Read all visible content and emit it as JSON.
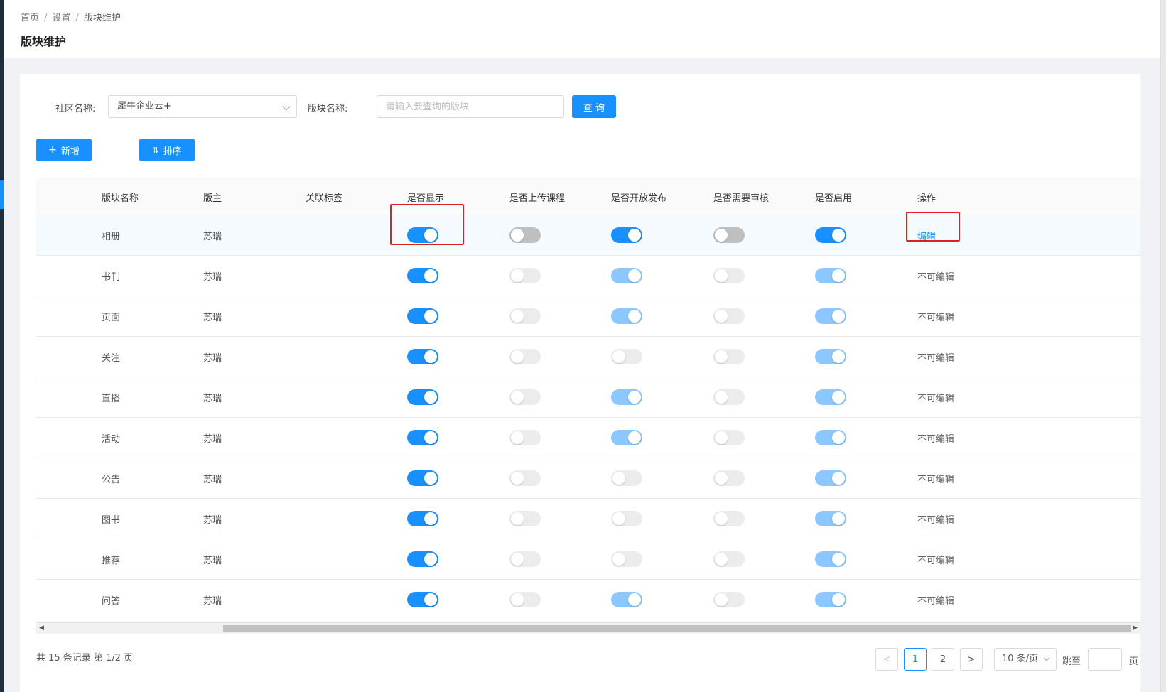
{
  "breadcrumb": [
    "首页",
    "设置",
    "版块维护"
  ],
  "page_title": "版块维护",
  "filters": {
    "community_label": "社区名称:",
    "community_value": "犀牛企业云+",
    "section_label": "版块名称:",
    "section_placeholder": "请输入要查询的版块",
    "query_button": "查 询"
  },
  "actions": {
    "add_label": "新增",
    "sort_label": "排序"
  },
  "table": {
    "columns": [
      "版块名称",
      "版主",
      "关联标签",
      "是否显示",
      "是否上传课程",
      "是否开放发布",
      "是否需要审核",
      "是否启用",
      "操作"
    ],
    "rows": [
      {
        "name": "相册",
        "owner": "苏瑞",
        "tag": "",
        "toggles": [
          "on",
          "off",
          "on",
          "off",
          "on"
        ],
        "action": "编辑"
      },
      {
        "name": "书刊",
        "owner": "苏瑞",
        "tag": "",
        "toggles": [
          "on",
          "off-dis",
          "on-dis",
          "off-dis",
          "on-dis"
        ],
        "action": "不可编辑"
      },
      {
        "name": "页面",
        "owner": "苏瑞",
        "tag": "",
        "toggles": [
          "on",
          "off-dis",
          "on-dis",
          "off-dis",
          "on-dis"
        ],
        "action": "不可编辑"
      },
      {
        "name": "关注",
        "owner": "苏瑞",
        "tag": "",
        "toggles": [
          "on",
          "off-dis",
          "off-dis",
          "off-dis",
          "on-dis"
        ],
        "action": "不可编辑"
      },
      {
        "name": "直播",
        "owner": "苏瑞",
        "tag": "",
        "toggles": [
          "on",
          "off-dis",
          "on-dis",
          "off-dis",
          "on-dis"
        ],
        "action": "不可编辑"
      },
      {
        "name": "活动",
        "owner": "苏瑞",
        "tag": "",
        "toggles": [
          "on",
          "off-dis",
          "on-dis",
          "off-dis",
          "on-dis"
        ],
        "action": "不可编辑"
      },
      {
        "name": "公告",
        "owner": "苏瑞",
        "tag": "",
        "toggles": [
          "on",
          "off-dis",
          "off-dis",
          "off-dis",
          "on-dis"
        ],
        "action": "不可编辑"
      },
      {
        "name": "图书",
        "owner": "苏瑞",
        "tag": "",
        "toggles": [
          "on",
          "off-dis",
          "off-dis",
          "off-dis",
          "on-dis"
        ],
        "action": "不可编辑"
      },
      {
        "name": "推荐",
        "owner": "苏瑞",
        "tag": "",
        "toggles": [
          "on",
          "off-dis",
          "off-dis",
          "off-dis",
          "on-dis"
        ],
        "action": "不可编辑"
      },
      {
        "name": "问答",
        "owner": "苏瑞",
        "tag": "",
        "toggles": [
          "on",
          "off-dis",
          "on-dis",
          "off-dis",
          "on-dis"
        ],
        "action": "不可编辑"
      }
    ]
  },
  "pagination": {
    "total_text": "共 15 条记录 第 1/2 页",
    "pages": [
      "1",
      "2"
    ],
    "current_page": "1",
    "page_size": "10 条/页",
    "jump_label": "跳至",
    "page_suffix": "页"
  },
  "colors": {
    "primary": "#1890ff",
    "highlight_box": "#e02020"
  }
}
